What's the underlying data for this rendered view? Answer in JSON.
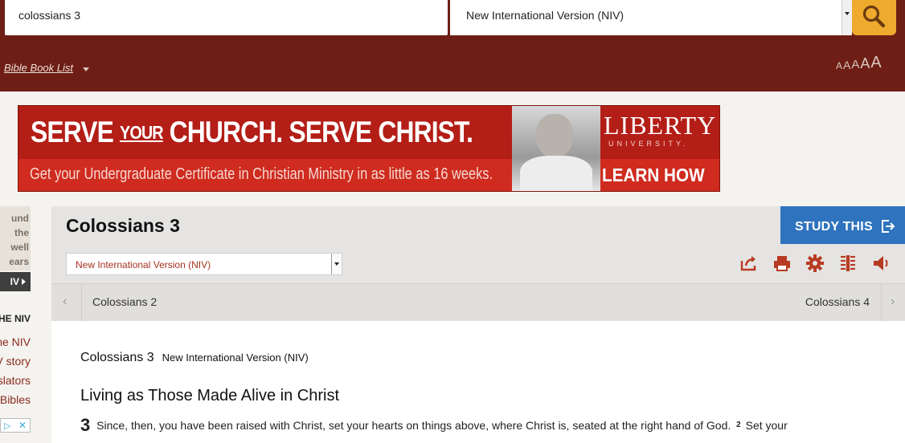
{
  "header": {
    "search_value": "colossians 3",
    "version_selected": "New International Version (NIV)",
    "book_list_label": "Bible Book List",
    "font_sizes": [
      "A",
      "A",
      "A",
      "A",
      "A"
    ]
  },
  "ad": {
    "headline_part1": "SERVE",
    "headline_your": "YOUR",
    "headline_part2": "CHURCH. SERVE CHRIST.",
    "subline": "Get your Undergraduate Certificate in Christian Ministry in as little as 16 weeks.",
    "logo": "LIBERTY",
    "logo_sub": "UNIVERSITY.",
    "cta": "LEARN HOW"
  },
  "sidebar": {
    "promo_lines": [
      "und",
      "the",
      "well",
      "ears"
    ],
    "dark_button": "IV",
    "heading": "HE NIV",
    "links": [
      "he NIV",
      "V story",
      "slators",
      "Bibles"
    ]
  },
  "passage": {
    "title": "Colossians 3",
    "study_label": "STUDY THIS",
    "version_select": "New International Version (NIV)",
    "prev_label": "Colossians 2",
    "next_label": "Colossians 4",
    "ref_book": "Colossians 3",
    "ref_version": "New International Version (NIV)",
    "section_heading": "Living as Those Made Alive in Christ",
    "chapter_number": "3",
    "verse1": "Since, then, you have been raised with Christ, set your hearts on things above, where Christ is, seated at the right hand of God.",
    "verse2_num": "2",
    "verse2": "Set your"
  },
  "colors": {
    "header": "#6e1e15",
    "search_button": "#edaa2d",
    "study_button": "#2f73be",
    "tool_icons": "#b83a22"
  },
  "icons": [
    "search-icon",
    "share-icon",
    "print-icon",
    "gear-icon",
    "parallel-icon",
    "audio-icon",
    "exit-icon"
  ]
}
